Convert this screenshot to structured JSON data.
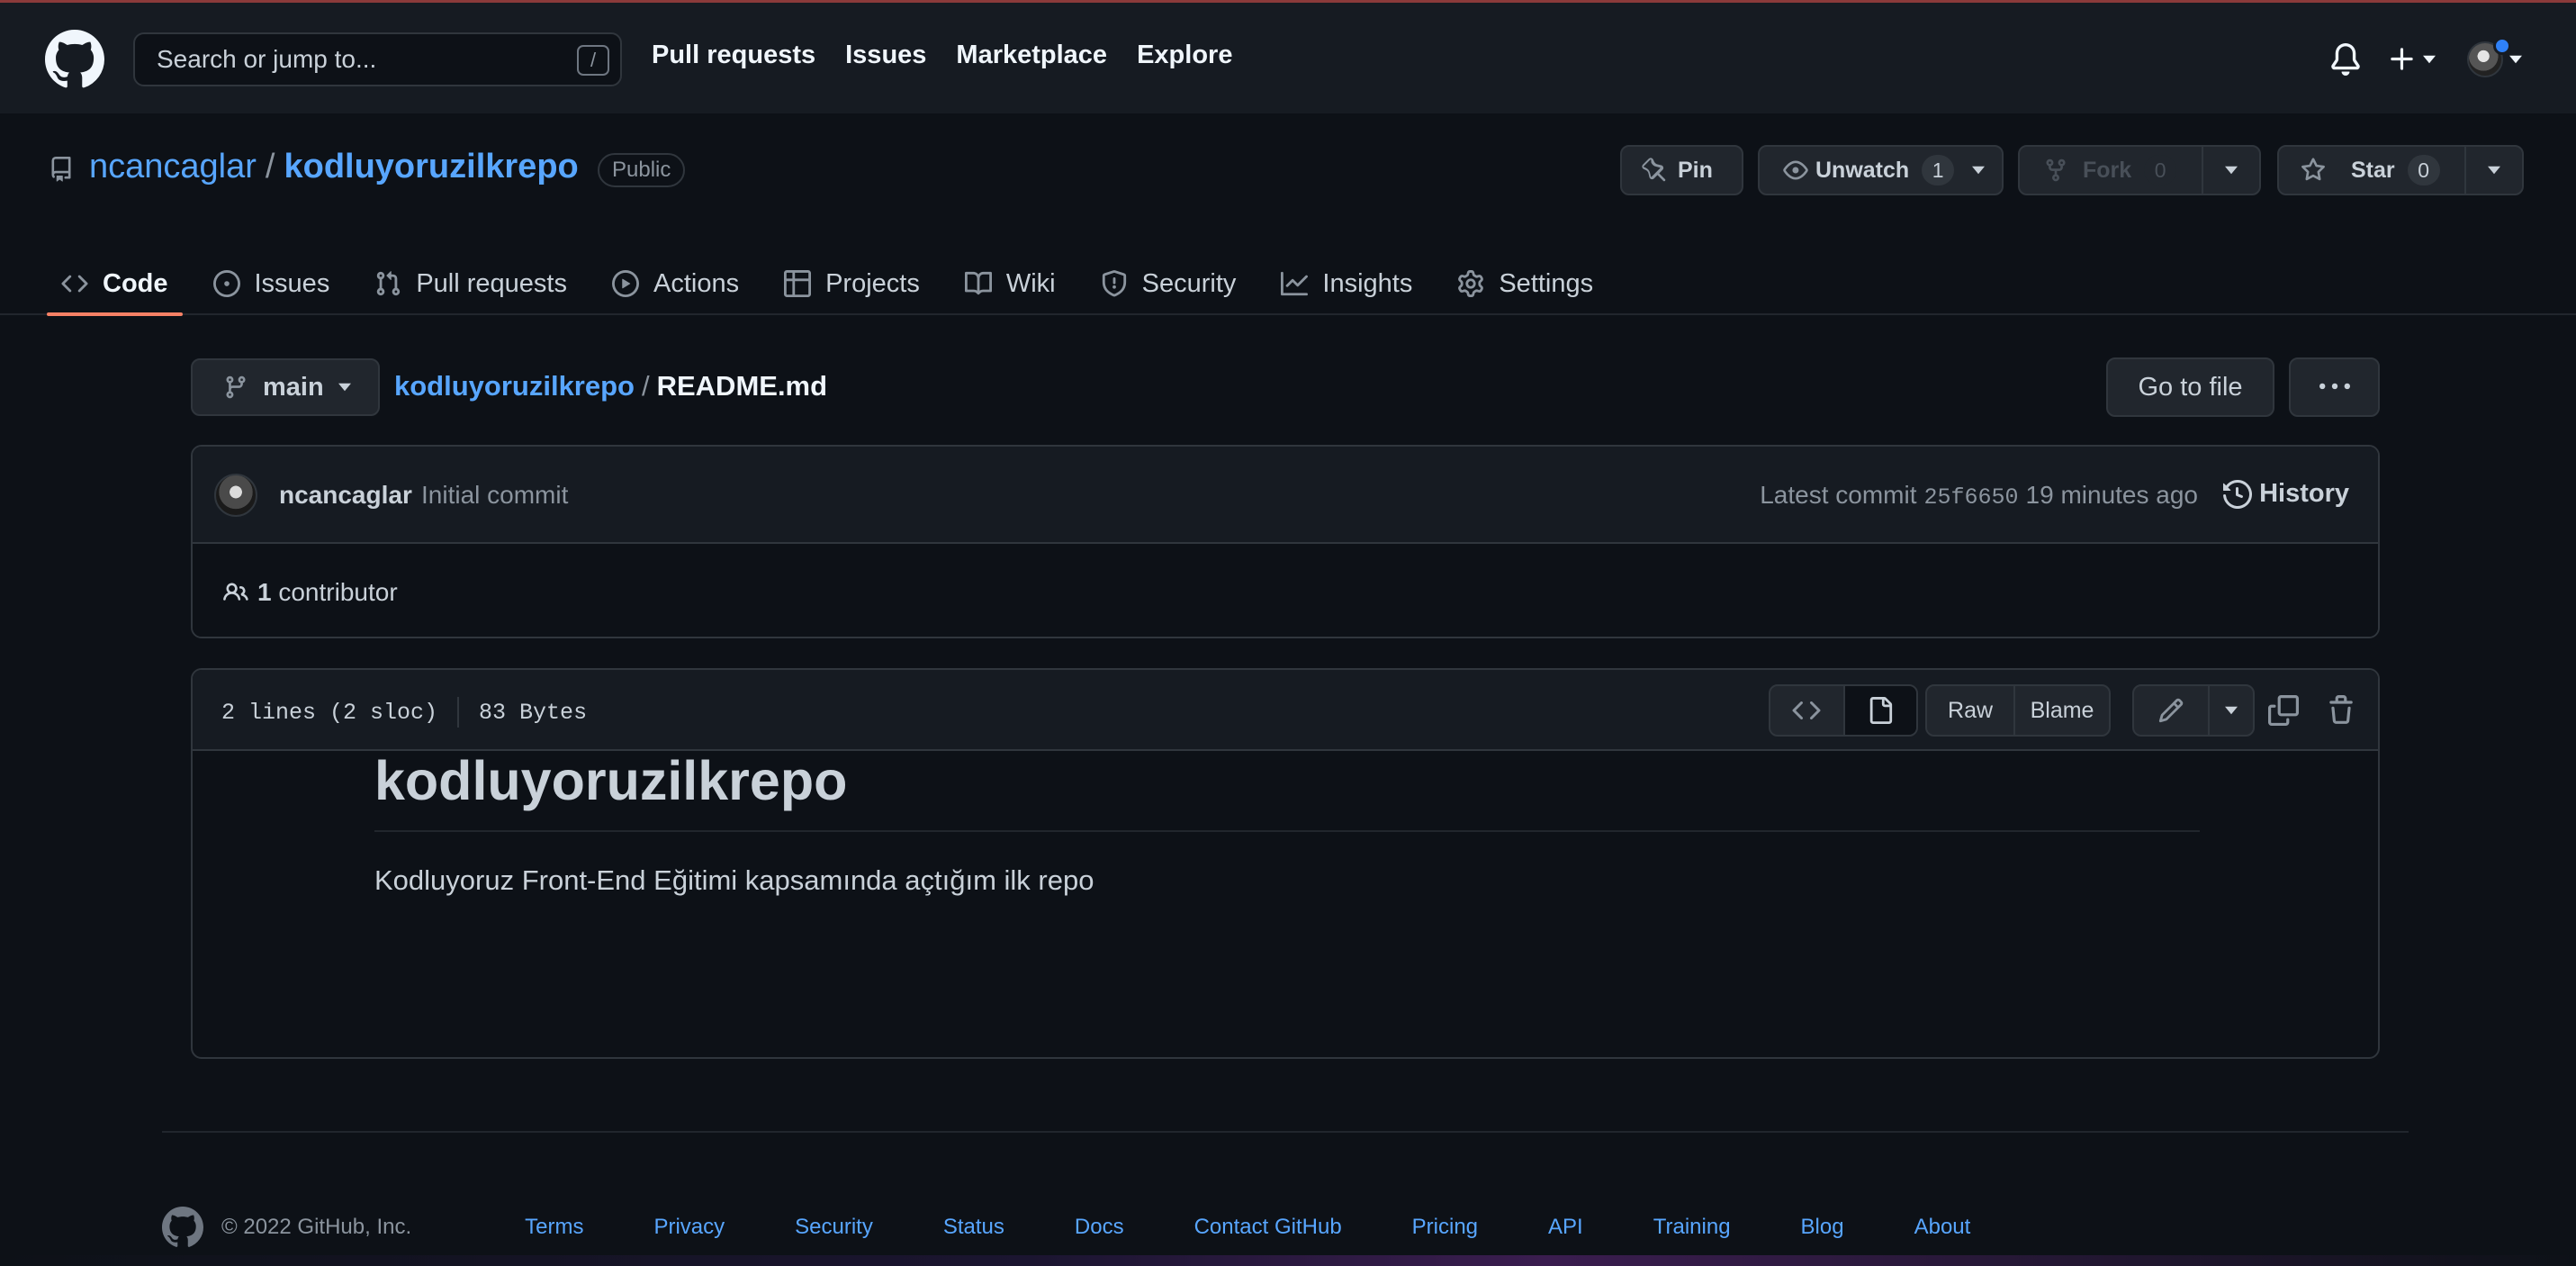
{
  "header": {
    "search_placeholder": "Search or jump to...",
    "search_shortcut": "/",
    "nav": [
      "Pull requests",
      "Issues",
      "Marketplace",
      "Explore"
    ]
  },
  "repo": {
    "owner": "ncancaglar",
    "separator": "/",
    "name": "kodluyoruzilkrepo",
    "visibility": "Public",
    "actions": {
      "pin_label": "Pin",
      "watch_label": "Unwatch",
      "watch_count": "1",
      "fork_label": "Fork",
      "fork_count": "0",
      "star_label": "Star",
      "star_count": "0"
    },
    "tabs": [
      "Code",
      "Issues",
      "Pull requests",
      "Actions",
      "Projects",
      "Wiki",
      "Security",
      "Insights",
      "Settings"
    ],
    "active_tab": "Code"
  },
  "file_nav": {
    "branch": "main",
    "repo_link": "kodluyoruzilkrepo",
    "separator": "/",
    "file_name": "README.md",
    "goto_label": "Go to file"
  },
  "commit": {
    "author": "ncancaglar",
    "message": "Initial commit",
    "latest_label": "Latest commit",
    "sha": "25f6650",
    "time": "19 minutes ago",
    "history_label": "History",
    "contributors_count": "1",
    "contributors_label": "contributor"
  },
  "file": {
    "lines": "2 lines (2 sloc)",
    "size": "83 Bytes",
    "raw_label": "Raw",
    "blame_label": "Blame",
    "readme_title": "kodluyoruzilkrepo",
    "readme_body": "Kodluyoruz Front-End Eğitimi kapsamında açtığım ilk repo"
  },
  "footer": {
    "copyright": "© 2022 GitHub, Inc.",
    "links": [
      "Terms",
      "Privacy",
      "Security",
      "Status",
      "Docs",
      "Contact GitHub",
      "Pricing",
      "API",
      "Training",
      "Blog",
      "About"
    ]
  },
  "colors": {
    "background": "#0d1117",
    "header_bg": "#161b22",
    "link": "#58a6ff",
    "active_tab_underline": "#f78166",
    "notification_dot": "#2f81f7"
  },
  "icons": {
    "logo": "github-mark-icon",
    "bell": "bell-icon",
    "plus": "plus-icon",
    "repo": "repo-icon",
    "branch": "git-branch-icon",
    "history": "history-icon",
    "people": "people-icon"
  }
}
